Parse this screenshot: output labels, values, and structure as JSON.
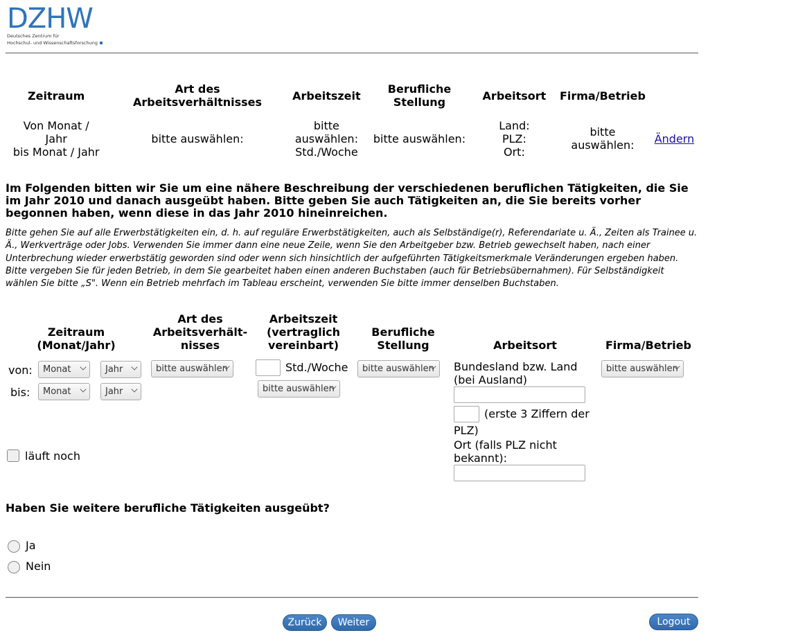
{
  "logo": {
    "word": "DZHW",
    "sub_line1": "Deutsches Zentrum für",
    "sub_line2": "Hochschul- und Wissenschaftsforschung",
    "color": "#2f74b8"
  },
  "summary": {
    "headers": [
      "Zeitraum",
      "Art des Arbeitsverhältnisses",
      "Arbeitszeit",
      "Berufliche Stellung",
      "Arbeitsort",
      "Firma/Betrieb"
    ],
    "row": {
      "zeitraum_line1": "Von Monat /",
      "zeitraum_line2": "Jahr",
      "zeitraum_line3": "bis Monat / Jahr",
      "art": "bitte auswählen:",
      "arbeitszeit_line1": "bitte",
      "arbeitszeit_line2": "auswählen:",
      "arbeitszeit_line3": "Std./Woche",
      "stellung": "bitte auswählen:",
      "ort_line1": "Land:",
      "ort_line2": "PLZ:",
      "ort_line3": "Ort:",
      "firma_line1": "bitte",
      "firma_line2": "auswählen:",
      "change_link": "Ändern"
    }
  },
  "intro": "Im Folgenden bitten wir Sie um eine nähere Beschreibung der verschiedenen beruflichen Tätigkeiten, die Sie im Jahr 2010 und danach ausgeübt haben. Bitte geben Sie auch Tätigkeiten an, die Sie bereits vorher begonnen haben, wenn diese in das Jahr 2010 hineinreichen.",
  "hint1": "Bitte gehen Sie auf alle Erwerbstätigkeiten ein, d. h. auf reguläre Erwerbstätigkeiten, auch als Selbständige(r), Referendariate u. Ä., Zeiten als Trainee u. Ä., Werkverträge oder Jobs. Verwenden Sie immer dann eine neue Zeile, wenn Sie den Arbeitgeber bzw. Betrieb gewechselt haben, nach einer Unterbrechung wieder erwerbstätig geworden sind oder wenn sich hinsichtlich der aufgeführten Tätigkeitsmerkmale Veränderungen ergeben haben.",
  "hint2": "Bitte vergeben Sie für jeden Betrieb, in dem Sie gearbeitet haben einen anderen Buchstaben (auch für Betriebsübernahmen). Für Selbständigkeit wählen Sie bitte „S\". Wenn ein Betrieb mehrfach im Tableau erscheint, verwenden Sie bitte immer denselben Buchstaben.",
  "entry": {
    "head_zeitraum_1": "Zeitraum",
    "head_zeitraum_2": "(Monat/Jahr)",
    "head_art_1": "Art des",
    "head_art_2": "Arbeitsverhält-",
    "head_art_3": "nisses",
    "head_az_1": "Arbeitszeit",
    "head_az_2": "(vertraglich",
    "head_az_3": "vereinbart)",
    "head_st_1": "Berufliche",
    "head_st_2": "Stellung",
    "head_ort": "Arbeitsort",
    "head_firma": "Firma/Betrieb",
    "von_label": "von:",
    "bis_label": "bis:",
    "monat": "Monat",
    "jahr": "Jahr",
    "select_placeholder": "bitte auswählen",
    "std_woche": "Std./Woche",
    "bundesland_1": "Bundesland bzw. Land",
    "bundesland_2": "(bei Ausland)",
    "plz_1": "(erste 3 Ziffern der",
    "plz_2": "PLZ)",
    "ort_1": "Ort (falls PLZ nicht",
    "ort_2": "bekannt):",
    "laeuft_noch": "läuft noch"
  },
  "question": {
    "text": "Haben Sie weitere berufliche Tätigkeiten ausgeübt?",
    "options": [
      "Ja",
      "Nein"
    ]
  },
  "footer": {
    "back": "Zurück",
    "next": "Weiter",
    "logout": "Logout",
    "button_color": "#3a74b8"
  }
}
